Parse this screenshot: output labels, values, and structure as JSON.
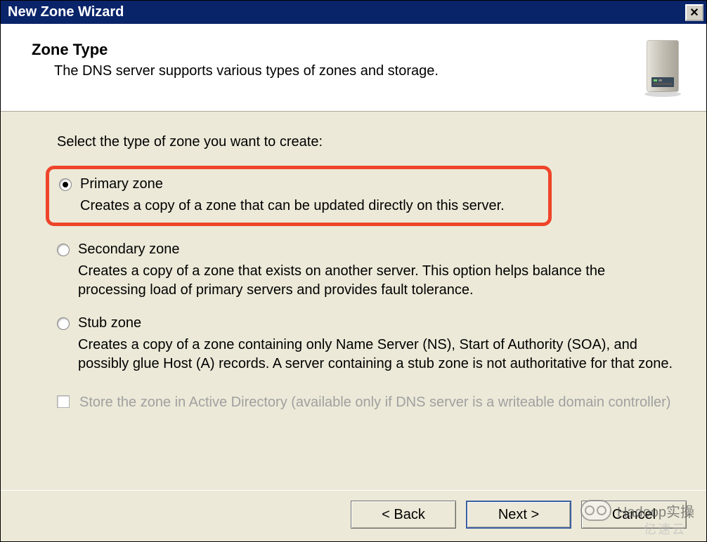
{
  "window": {
    "title": "New Zone Wizard"
  },
  "header": {
    "title": "Zone Type",
    "subtitle": "The DNS server supports various types of zones and storage."
  },
  "content": {
    "prompt": "Select the type of zone you want to create:",
    "options": {
      "primary": {
        "label": "Primary zone",
        "desc": "Creates a copy of a zone that can be updated directly on this server.",
        "selected": true
      },
      "secondary": {
        "label": "Secondary zone",
        "desc": "Creates a copy of a zone that exists on another server. This option helps balance the processing load of primary servers and provides fault tolerance.",
        "selected": false
      },
      "stub": {
        "label": "Stub zone",
        "desc": "Creates a copy of a zone containing only Name Server (NS), Start of Authority (SOA), and possibly glue Host (A) records. A server containing a stub zone is not authoritative for that zone.",
        "selected": false
      }
    },
    "checkbox": {
      "label": "Store the zone in Active Directory (available only if DNS server is a writeable domain controller)",
      "enabled": false
    }
  },
  "buttons": {
    "back": "< Back",
    "next": "Next >",
    "cancel": "Cancel"
  },
  "watermark": {
    "text1": "Hadoop实操",
    "text2": "亿速云"
  }
}
